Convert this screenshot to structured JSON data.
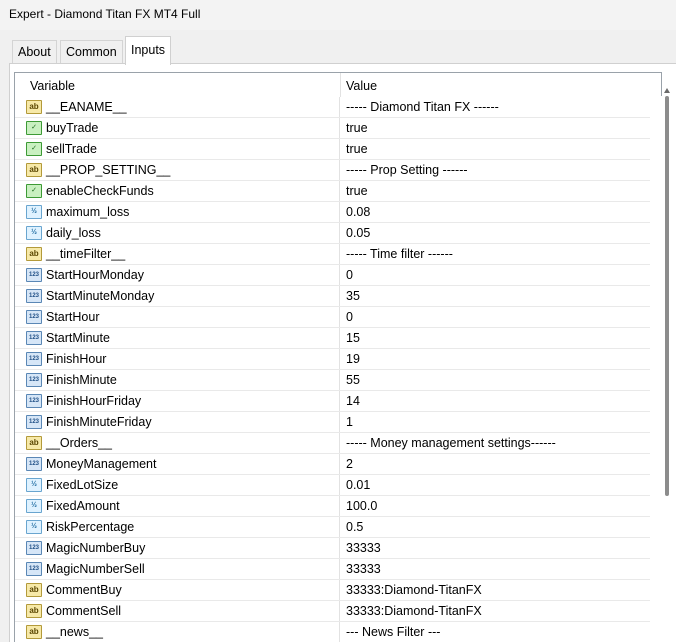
{
  "window": {
    "title": "Expert - Diamond Titan FX MT4 Full"
  },
  "tabs": [
    {
      "label": "About"
    },
    {
      "label": "Common"
    },
    {
      "label": "Inputs"
    }
  ],
  "table": {
    "headers": {
      "variable": "Variable",
      "value": "Value"
    },
    "rows": [
      {
        "icon": "ab",
        "name": "__EANAME__",
        "value": "----- Diamond Titan FX ------"
      },
      {
        "icon": "bool",
        "name": "buyTrade",
        "value": "true"
      },
      {
        "icon": "bool",
        "name": "sellTrade",
        "value": "true"
      },
      {
        "icon": "ab",
        "name": "__PROP_SETTING__",
        "value": "----- Prop Setting ------"
      },
      {
        "icon": "bool",
        "name": "enableCheckFunds",
        "value": "true"
      },
      {
        "icon": "dbl",
        "name": "maximum_loss",
        "value": "0.08"
      },
      {
        "icon": "dbl",
        "name": "daily_loss",
        "value": "0.05"
      },
      {
        "icon": "ab",
        "name": "__timeFilter__",
        "value": "----- Time filter ------"
      },
      {
        "icon": "num",
        "name": "StartHourMonday",
        "value": "0"
      },
      {
        "icon": "num",
        "name": "StartMinuteMonday",
        "value": "35"
      },
      {
        "icon": "num",
        "name": "StartHour",
        "value": "0"
      },
      {
        "icon": "num",
        "name": "StartMinute",
        "value": "15"
      },
      {
        "icon": "num",
        "name": "FinishHour",
        "value": "19"
      },
      {
        "icon": "num",
        "name": "FinishMinute",
        "value": "55"
      },
      {
        "icon": "num",
        "name": "FinishHourFriday",
        "value": "14"
      },
      {
        "icon": "num",
        "name": "FinishMinuteFriday",
        "value": "1"
      },
      {
        "icon": "ab",
        "name": "__Orders__",
        "value": "----- Money management settings------"
      },
      {
        "icon": "num",
        "name": "MoneyManagement",
        "value": "2"
      },
      {
        "icon": "dbl",
        "name": "FixedLotSize",
        "value": "0.01"
      },
      {
        "icon": "dbl",
        "name": "FixedAmount",
        "value": "100.0"
      },
      {
        "icon": "dbl",
        "name": "RiskPercentage",
        "value": "0.5"
      },
      {
        "icon": "num",
        "name": "MagicNumberBuy",
        "value": "33333"
      },
      {
        "icon": "num",
        "name": "MagicNumberSell",
        "value": "33333"
      },
      {
        "icon": "ab",
        "name": "CommentBuy",
        "value": "33333:Diamond-TitanFX"
      },
      {
        "icon": "ab",
        "name": "CommentSell",
        "value": "33333:Diamond-TitanFX"
      },
      {
        "icon": "ab",
        "name": "__news__",
        "value": "--- News Filter ---"
      }
    ]
  },
  "icon_glyphs": {
    "ab": "ab",
    "bool": "✓",
    "num": "123",
    "dbl": "½"
  }
}
